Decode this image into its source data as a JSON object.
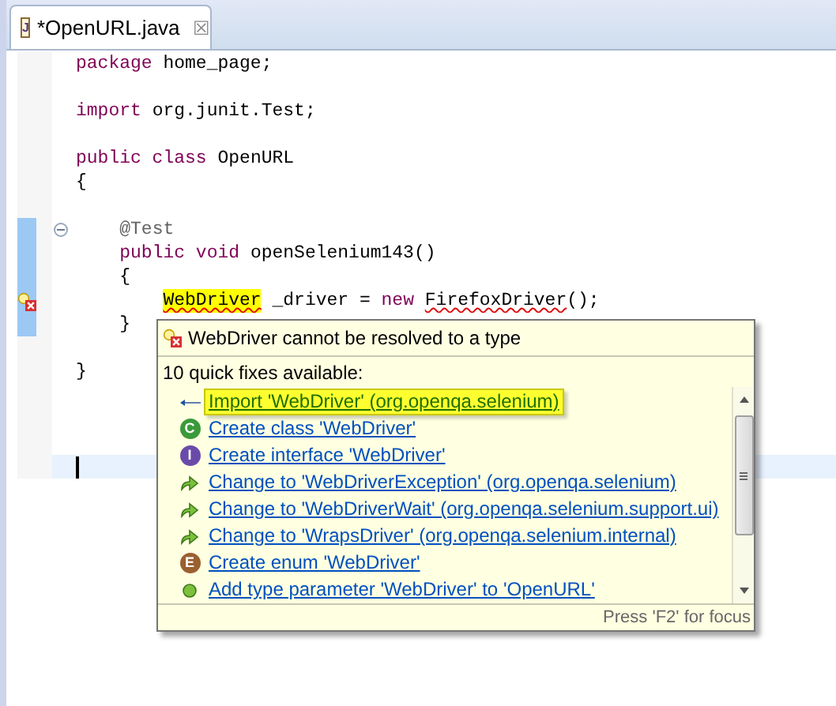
{
  "tab": {
    "icon_letter": "J",
    "title": "*OpenURL.java",
    "close_glyph": "☒"
  },
  "editor": {
    "lines": [
      {
        "tokens": [
          {
            "kind": "keyword",
            "text": "package"
          },
          {
            "kind": "plain",
            "text": " home_page;"
          }
        ],
        "occurrence": false,
        "error": false,
        "fold": false,
        "current": false
      },
      {
        "occurrence": false,
        "error": false,
        "fold": false,
        "current": false
      },
      {
        "tokens": [
          {
            "kind": "keyword",
            "text": "import"
          },
          {
            "kind": "plain",
            "text": " org.junit.Test;"
          }
        ],
        "occurrence": false,
        "error": false,
        "fold": false,
        "current": false
      },
      {
        "occurrence": false,
        "error": false,
        "fold": false,
        "current": false
      },
      {
        "tokens": [
          {
            "kind": "keyword",
            "text": "public class"
          },
          {
            "kind": "plain",
            "text": " OpenURL"
          }
        ],
        "occurrence": false,
        "error": false,
        "fold": false,
        "current": false
      },
      {
        "tokens": [
          {
            "kind": "plain",
            "text": "{"
          }
        ],
        "occurrence": false,
        "error": false,
        "fold": false,
        "current": false
      },
      {
        "occurrence": false,
        "error": false,
        "fold": false,
        "current": false
      },
      {
        "tokens": [
          {
            "kind": "annotation",
            "text": "    @Test"
          }
        ],
        "occurrence": true,
        "error": false,
        "fold": true,
        "current": false
      },
      {
        "tokens": [
          {
            "kind": "keyword",
            "text": "    public void"
          },
          {
            "kind": "plain",
            "text": " openSelenium143()"
          }
        ],
        "occurrence": true,
        "error": false,
        "fold": false,
        "current": false
      },
      {
        "tokens": [
          {
            "kind": "plain",
            "text": "    {"
          }
        ],
        "occurrence": true,
        "error": false,
        "fold": false,
        "current": false
      },
      {
        "tokens": [
          {
            "kind": "marked",
            "text": "        WebDriver"
          },
          {
            "kind": "plain",
            "text": " _driver = "
          },
          {
            "kind": "keyword",
            "text": "new"
          },
          {
            "kind": "error",
            "text": " FirefoxDriver"
          },
          {
            "kind": "plain",
            "text": "();"
          }
        ],
        "occurrence": true,
        "error": true,
        "fold": false,
        "current": false
      },
      {
        "tokens": [
          {
            "kind": "plain",
            "text": "    }"
          }
        ],
        "occurrence": true,
        "error": false,
        "fold": false,
        "current": false
      },
      {
        "occurrence": false,
        "error": false,
        "fold": false,
        "current": false
      },
      {
        "tokens": [
          {
            "kind": "plain",
            "text": "}"
          }
        ],
        "occurrence": false,
        "error": false,
        "fold": false,
        "current": false
      },
      {
        "occurrence": false,
        "error": false,
        "fold": false,
        "current": false
      },
      {
        "occurrence": false,
        "error": false,
        "fold": false,
        "current": false
      },
      {
        "occurrence": false,
        "error": false,
        "fold": false,
        "current": false
      },
      {
        "occurrence": false,
        "error": false,
        "fold": false,
        "current": true
      }
    ]
  },
  "quick_fix": {
    "problem": "WebDriver cannot be resolved to a type",
    "count_label": "10 quick fixes available:",
    "items": [
      {
        "kind": "import",
        "label": "Import 'WebDriver' (org.openqa.selenium)",
        "selected": true
      },
      {
        "kind": "class",
        "badge": "C",
        "label": "Create class 'WebDriver'",
        "selected": false
      },
      {
        "kind": "interface",
        "badge": "I",
        "label": "Create interface 'WebDriver'",
        "selected": false
      },
      {
        "kind": "change",
        "label": "Change to 'WebDriverException' (org.openqa.selenium)",
        "selected": false
      },
      {
        "kind": "change",
        "label": "Change to 'WebDriverWait' (org.openqa.selenium.support.ui)",
        "selected": false
      },
      {
        "kind": "change",
        "label": "Change to 'WrapsDriver' (org.openqa.selenium.internal)",
        "selected": false
      },
      {
        "kind": "enum",
        "badge": "E",
        "label": "Create enum 'WebDriver'",
        "selected": false
      },
      {
        "kind": "add",
        "label": "Add type parameter 'WebDriver' to 'OpenURL'",
        "selected": false
      }
    ],
    "footer": "Press 'F2' for focus"
  }
}
